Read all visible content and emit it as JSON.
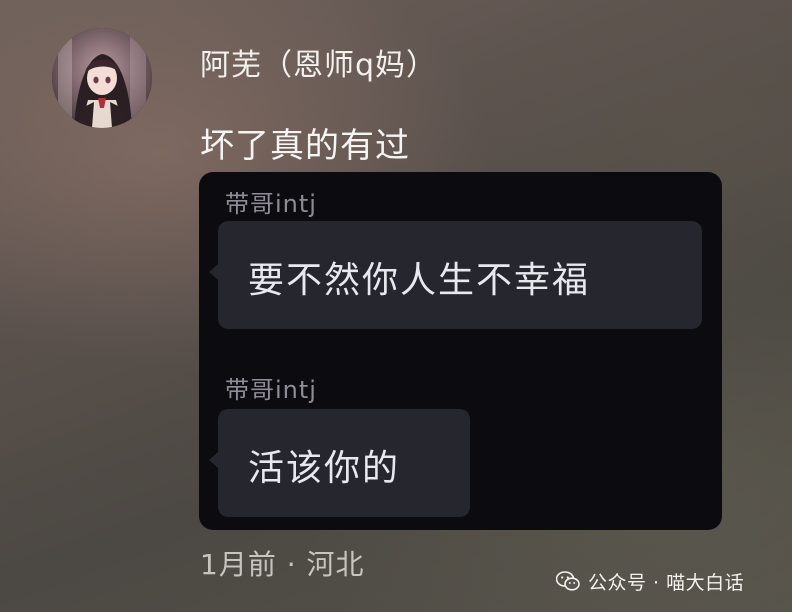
{
  "comment": {
    "username": "阿芜（恩师q妈）",
    "text": "坏了真的有过",
    "meta": "1月前 · 河北"
  },
  "chat_image": {
    "messages": [
      {
        "sender": "带哥intj",
        "text": "要不然你人生不幸福"
      },
      {
        "sender": "带哥intj",
        "text": "活该你的"
      }
    ]
  },
  "watermark": {
    "text": "公众号 · 喵大白话",
    "icon": "wechat-icon"
  },
  "colors": {
    "chat_background": "#0c0b10",
    "bubble": "#25262e",
    "sender_name": "#8f8c98",
    "primary_text": "#f3f0ee"
  }
}
